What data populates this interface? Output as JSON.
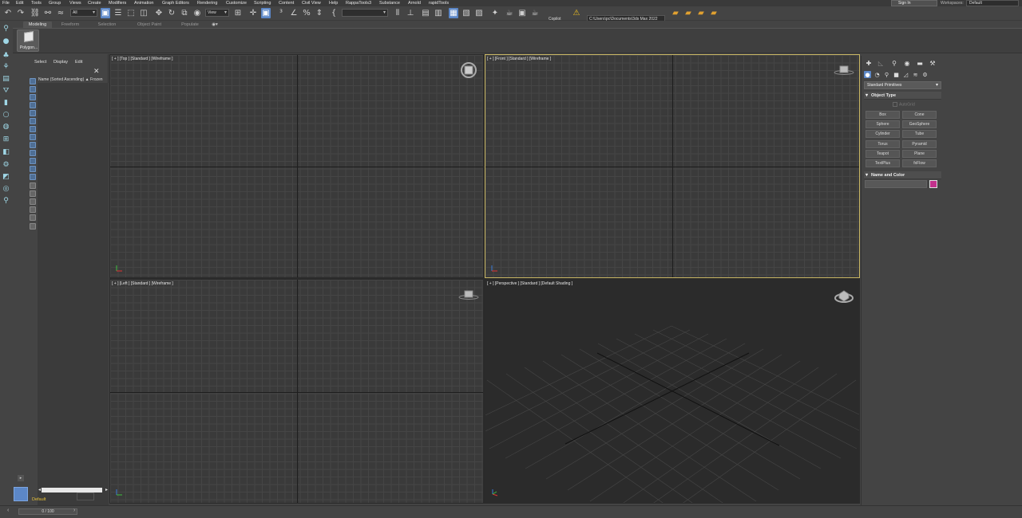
{
  "menubar": {
    "items": [
      "File",
      "Edit",
      "Tools",
      "Group",
      "Views",
      "Create",
      "Modifiers",
      "Animation",
      "Graph Editors",
      "Rendering",
      "Customize",
      "Scripting",
      "Content",
      "Civil View",
      "Help",
      "RappaTools3",
      "Substance",
      "Arnold",
      "rapidTools"
    ],
    "sign_in": "Sign In",
    "workspaces_label": "Workspaces:",
    "workspace_value": "Default"
  },
  "toolbar": {
    "selection_filter": "All",
    "reference_coord": "View",
    "copilot_label": "Copilot",
    "project_path": "C:\\Users\\pc\\Documents\\3ds Max 2022"
  },
  "ribbon": {
    "tabs": [
      "Modeling",
      "Freeform",
      "Selection",
      "Object Paint",
      "Populate"
    ],
    "active_tab": "Modeling",
    "polygon_button": "Polygon..."
  },
  "explorer": {
    "menu": [
      "Select",
      "Display",
      "Edit"
    ],
    "column_header": "Name (Sorted Ascending) ▲ Frozen",
    "layer_name": "Default"
  },
  "viewports": {
    "top": "[ + ] [Top ] [Standard ] [Wireframe ]",
    "front": "[ + ] [Front ] [Standard ] [Wireframe ]",
    "left": "[ + ] [Left ] [Standard ] [Wireframe ]",
    "perspective": "[ + ] [Perspective ] [Standard ] [Default Shading ]",
    "active": "front"
  },
  "command_panel": {
    "category": "Standard Primitives",
    "object_type_title": "Object Type",
    "autogrid_label": "AutoGrid",
    "primitives": [
      "Box",
      "Cone",
      "Sphere",
      "GeoSphere",
      "Cylinder",
      "Tube",
      "Torus",
      "Pyramid",
      "Teapot",
      "Plane",
      "TextPlus",
      "fxFlow"
    ],
    "name_color_title": "Name and Color",
    "object_color": "#c2318c"
  },
  "timeline": {
    "frame_display": "0 / 100"
  },
  "colors": {
    "accent": "#5c87c7",
    "active_viewport_border": "#c7b562",
    "layer_name_color": "#e8c23a"
  }
}
